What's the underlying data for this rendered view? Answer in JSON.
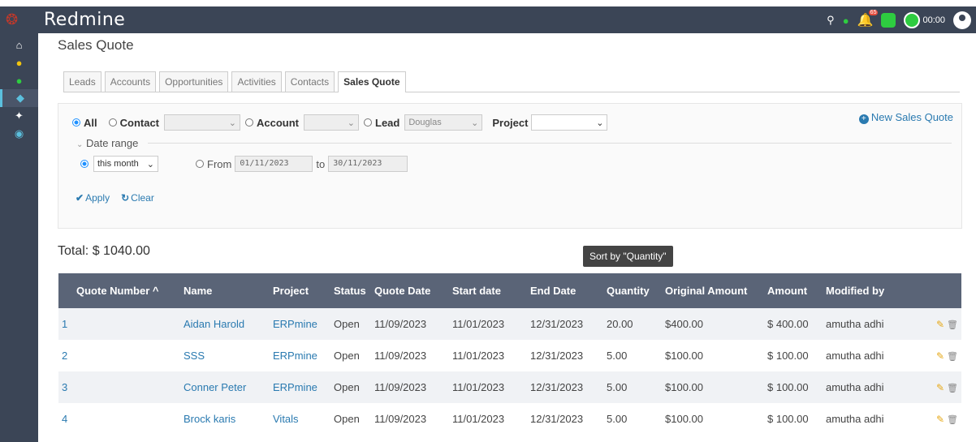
{
  "app": {
    "title": "Redmine",
    "timer": "00:00",
    "notif_count": "65"
  },
  "page": {
    "title": "Sales Quote"
  },
  "tabs": [
    "Leads",
    "Accounts",
    "Opportunities",
    "Activities",
    "Contacts",
    "Sales Quote"
  ],
  "filter": {
    "all_label": "All",
    "contact_label": "Contact",
    "account_label": "Account",
    "lead_label": "Lead",
    "lead_value": "Douglas",
    "project_label": "Project",
    "new_label": "New Sales Quote",
    "date_range_label": "Date range",
    "period_value": "this month",
    "from_label": "From",
    "from_value": "01/11/2023",
    "to_label": "to",
    "to_value": "30/11/2023",
    "apply_label": "Apply",
    "clear_label": "Clear"
  },
  "total": {
    "label": "Total:",
    "value": "$ 1040.00"
  },
  "tooltip": "Sort by \"Quantity\"",
  "table": {
    "headers": [
      "Quote Number ^",
      "Name",
      "Project",
      "Status",
      "Quote Date",
      "Start date",
      "End Date",
      "Quantity",
      "Original Amount",
      "Amount",
      "Modified by"
    ],
    "rows": [
      {
        "num": "1",
        "name": "Aidan Harold",
        "project": "ERPmine",
        "status": "Open",
        "qdate": "11/09/2023",
        "sdate": "11/01/2023",
        "edate": "12/31/2023",
        "qty": "20.00",
        "orig": "$400.00",
        "amount": "$ 400.00",
        "by": "amutha adhi"
      },
      {
        "num": "2",
        "name": "SSS",
        "project": "ERPmine",
        "status": "Open",
        "qdate": "11/09/2023",
        "sdate": "11/01/2023",
        "edate": "12/31/2023",
        "qty": "5.00",
        "orig": "$100.00",
        "amount": "$ 100.00",
        "by": "amutha adhi"
      },
      {
        "num": "3",
        "name": "Conner Peter",
        "project": "ERPmine",
        "status": "Open",
        "qdate": "11/09/2023",
        "sdate": "11/01/2023",
        "edate": "12/31/2023",
        "qty": "5.00",
        "orig": "$100.00",
        "amount": "$ 100.00",
        "by": "amutha adhi"
      },
      {
        "num": "4",
        "name": "Brock karis",
        "project": "Vitals",
        "status": "Open",
        "qdate": "11/09/2023",
        "sdate": "11/01/2023",
        "edate": "12/31/2023",
        "qty": "5.00",
        "orig": "$100.00",
        "amount": "$ 100.00",
        "by": "amutha adhi"
      }
    ]
  }
}
